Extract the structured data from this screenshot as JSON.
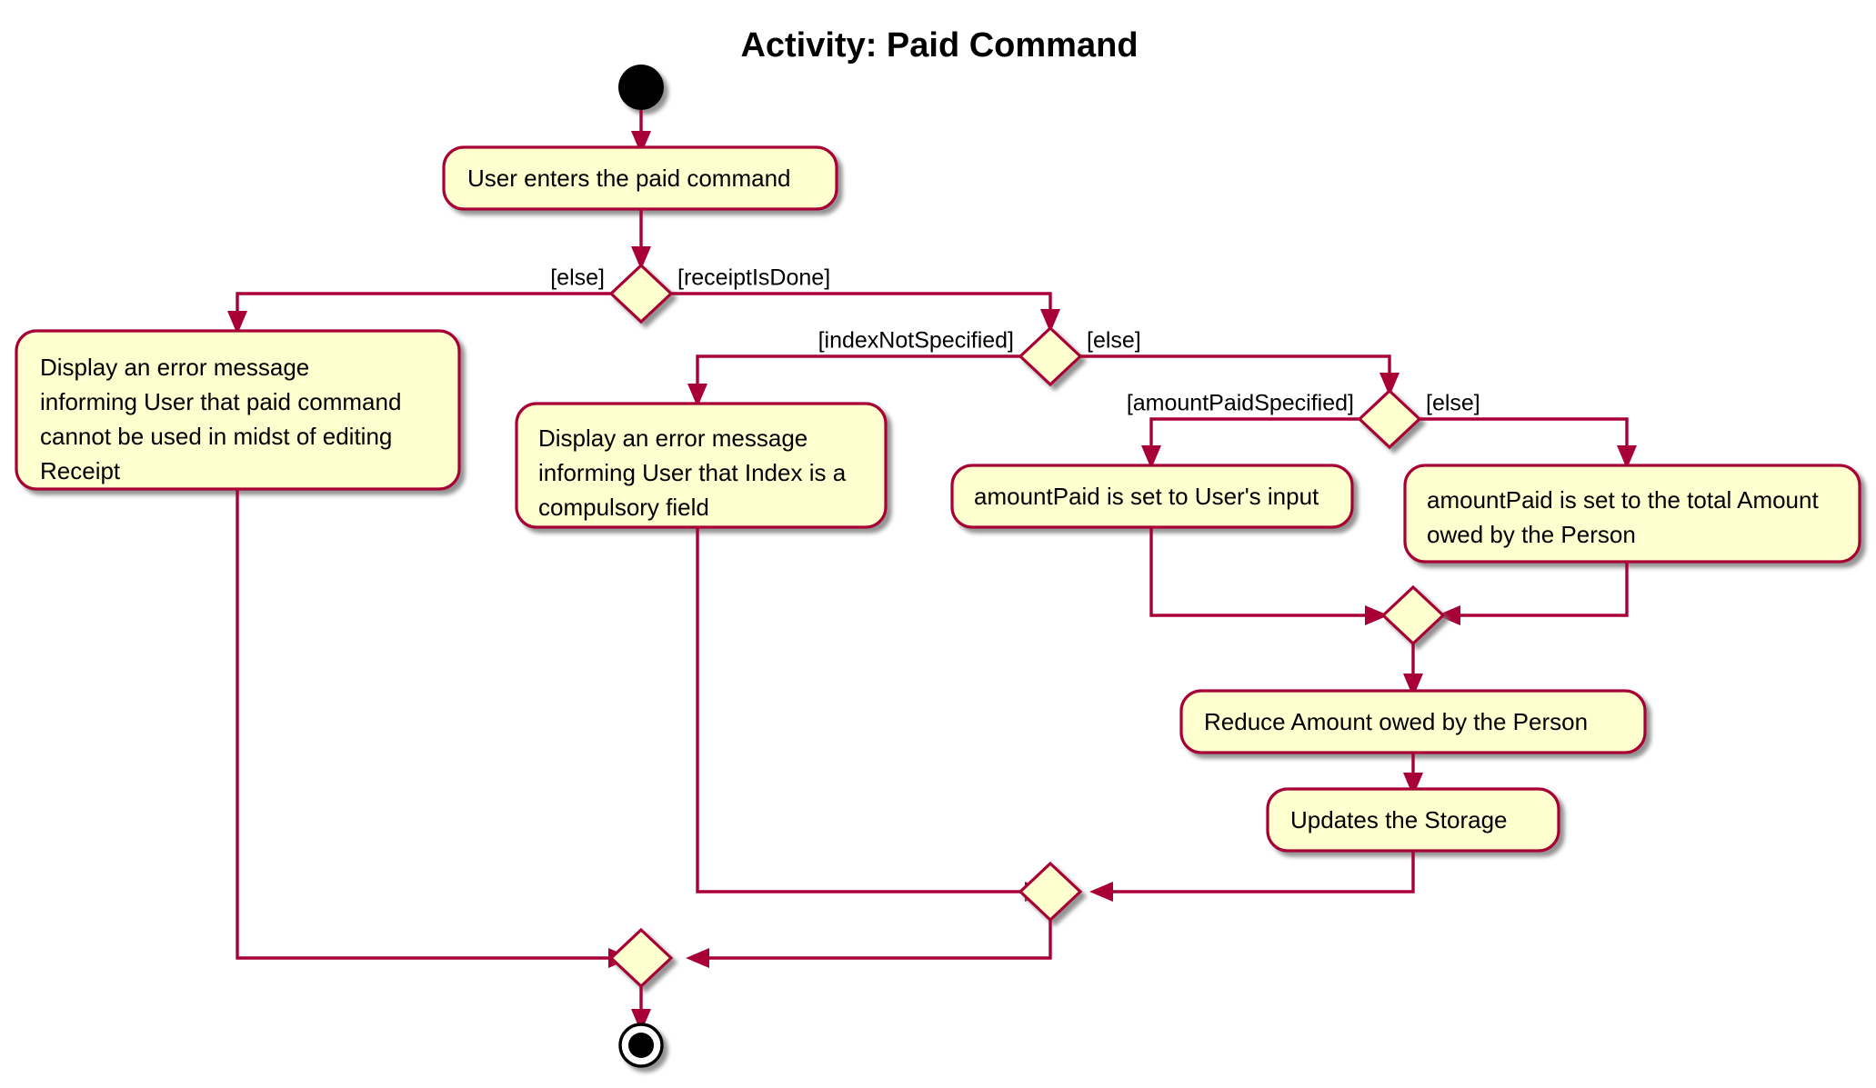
{
  "diagram": {
    "title": "Activity: Paid Command",
    "type": "uml-activity-diagram",
    "colors": {
      "node_fill": "#FEFECE",
      "node_border": "#A80036",
      "line": "#A80036",
      "text": "#000000",
      "background": "#FFFFFF",
      "shadow": "#888888"
    },
    "start_node": "start-filled-circle",
    "end_node": "end-bullseye-circle",
    "activities": [
      {
        "id": "user-enters-paid-command",
        "lines": [
          "User enters the paid command"
        ]
      },
      {
        "id": "error-editing-receipt",
        "lines": [
          "Display an error message",
          "informing User that paid command",
          "cannot be used in midst of editing",
          "Receipt"
        ]
      },
      {
        "id": "error-index-compulsory",
        "lines": [
          "Display an error message",
          "informing User that Index is a",
          "compulsory field"
        ]
      },
      {
        "id": "amount-paid-user-input",
        "lines": [
          "amountPaid is set to User's input"
        ]
      },
      {
        "id": "amount-paid-total-owed",
        "lines": [
          "amountPaid is set to the total Amount",
          "owed by the Person"
        ]
      },
      {
        "id": "reduce-amount-owed",
        "lines": [
          "Reduce Amount owed by the Person"
        ]
      },
      {
        "id": "updates-the-storage",
        "lines": [
          "Updates the Storage"
        ]
      }
    ],
    "decisions": [
      {
        "id": "receipt-is-done-decision",
        "left_guard": "[else]",
        "right_guard": "[receiptIsDone]"
      },
      {
        "id": "index-specified-decision",
        "left_guard": "[indexNotSpecified]",
        "right_guard": "[else]"
      },
      {
        "id": "amount-paid-specified-decision",
        "left_guard": "[amountPaidSpecified]",
        "right_guard": "[else]"
      }
    ],
    "merges": [
      {
        "id": "merge-amount-paid"
      },
      {
        "id": "merge-index-branch"
      },
      {
        "id": "merge-final"
      }
    ]
  }
}
